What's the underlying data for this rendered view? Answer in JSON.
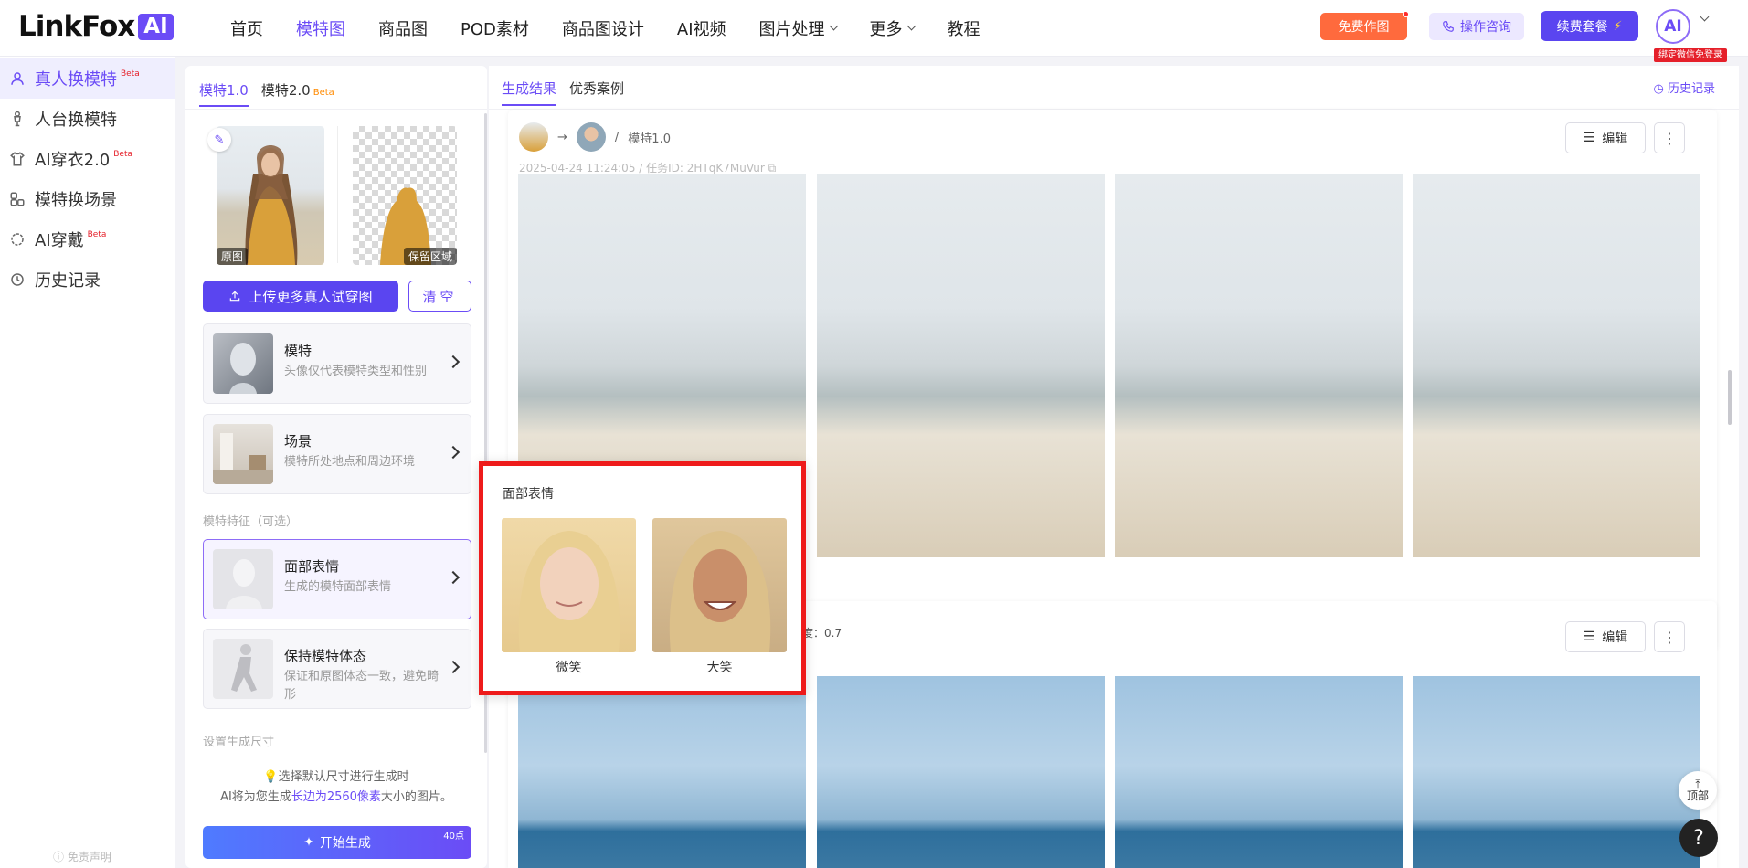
{
  "topbar": {
    "logo_text": "LinkFox",
    "logo_badge": "AI",
    "nav": [
      {
        "label": "首页",
        "active": false,
        "dropdown": false
      },
      {
        "label": "模特图",
        "active": true,
        "dropdown": false
      },
      {
        "label": "商品图",
        "active": false,
        "dropdown": false
      },
      {
        "label": "POD素材",
        "active": false,
        "dropdown": false
      },
      {
        "label": "商品图设计",
        "active": false,
        "dropdown": false
      },
      {
        "label": "AI视频",
        "active": false,
        "dropdown": false
      },
      {
        "label": "图片处理",
        "active": false,
        "dropdown": true
      },
      {
        "label": "更多",
        "active": false,
        "dropdown": true
      },
      {
        "label": "教程",
        "active": false,
        "dropdown": false
      }
    ],
    "free_button": "免费作图",
    "consult_button": "操作咨询",
    "renew_button": "续费套餐",
    "avatar_text": "AI",
    "bind_badge": "绑定微信免登录"
  },
  "sidebar": {
    "items": [
      {
        "label": "真人换模特",
        "beta": "Beta",
        "icon": "person-swap-icon",
        "active": true
      },
      {
        "label": "人台换模特",
        "beta": "",
        "icon": "mannequin-icon",
        "active": false
      },
      {
        "label": "AI穿衣2.0",
        "beta": "Beta",
        "icon": "shirt-icon",
        "active": false
      },
      {
        "label": "模特换场景",
        "beta": "",
        "icon": "scene-icon",
        "active": false
      },
      {
        "label": "AI穿戴",
        "beta": "Beta",
        "icon": "ring-icon",
        "active": false
      },
      {
        "label": "历史记录",
        "beta": "",
        "icon": "history-icon",
        "active": false
      }
    ],
    "disclaimer": "免责声明"
  },
  "panel": {
    "tabs": [
      {
        "label": "模特1.0",
        "beta": "",
        "active": true
      },
      {
        "label": "模特2.0",
        "beta": "Beta",
        "active": false
      }
    ],
    "original_label": "原图",
    "mask_label": "保留区域",
    "upload_button": "上传更多真人试穿图",
    "clear_button": "清空",
    "options": [
      {
        "title": "模特",
        "desc": "头像仅代表模特类型和性别"
      },
      {
        "title": "场景",
        "desc": "模特所处地点和周边环境"
      }
    ],
    "features_title": "模特特征（可选）",
    "features": [
      {
        "title": "面部表情",
        "desc": "生成的模特面部表情",
        "selected": true
      },
      {
        "title": "保持模特体态",
        "desc": "保证和原图体态一致，避免畸形",
        "selected": false
      }
    ],
    "size_title": "设置生成尺寸",
    "hint_line1": "选择默认尺寸进行生成时",
    "hint_line2_pre": "AI将为您生成",
    "hint_line2_hl": "长边为2560像素",
    "hint_line2_post": "大小的图片。",
    "start_button": "开始生成",
    "points_badge": "40点"
  },
  "results": {
    "tabs": [
      {
        "label": "生成结果",
        "active": true
      },
      {
        "label": "优秀案例",
        "active": false
      }
    ],
    "history_link": "历史记录",
    "card1": {
      "model_version": "模特1.0",
      "timestamp": "2025-04-24 11:24:05",
      "task_label": "任务ID:",
      "task_id": "2HTqK7MuVur",
      "edit_button": "编辑"
    },
    "card2": {
      "prompt_tail": "度：0.7",
      "edit_button": "编辑"
    }
  },
  "popover": {
    "title": "面部表情",
    "options": [
      {
        "label": "微笑"
      },
      {
        "label": "大笑"
      }
    ]
  },
  "floating": {
    "to_top": "顶部",
    "help": "?"
  },
  "colors": {
    "accent": "#6b4cf6",
    "free_button": "#ff6a3d",
    "highlight_border": "#ee1b1b"
  }
}
